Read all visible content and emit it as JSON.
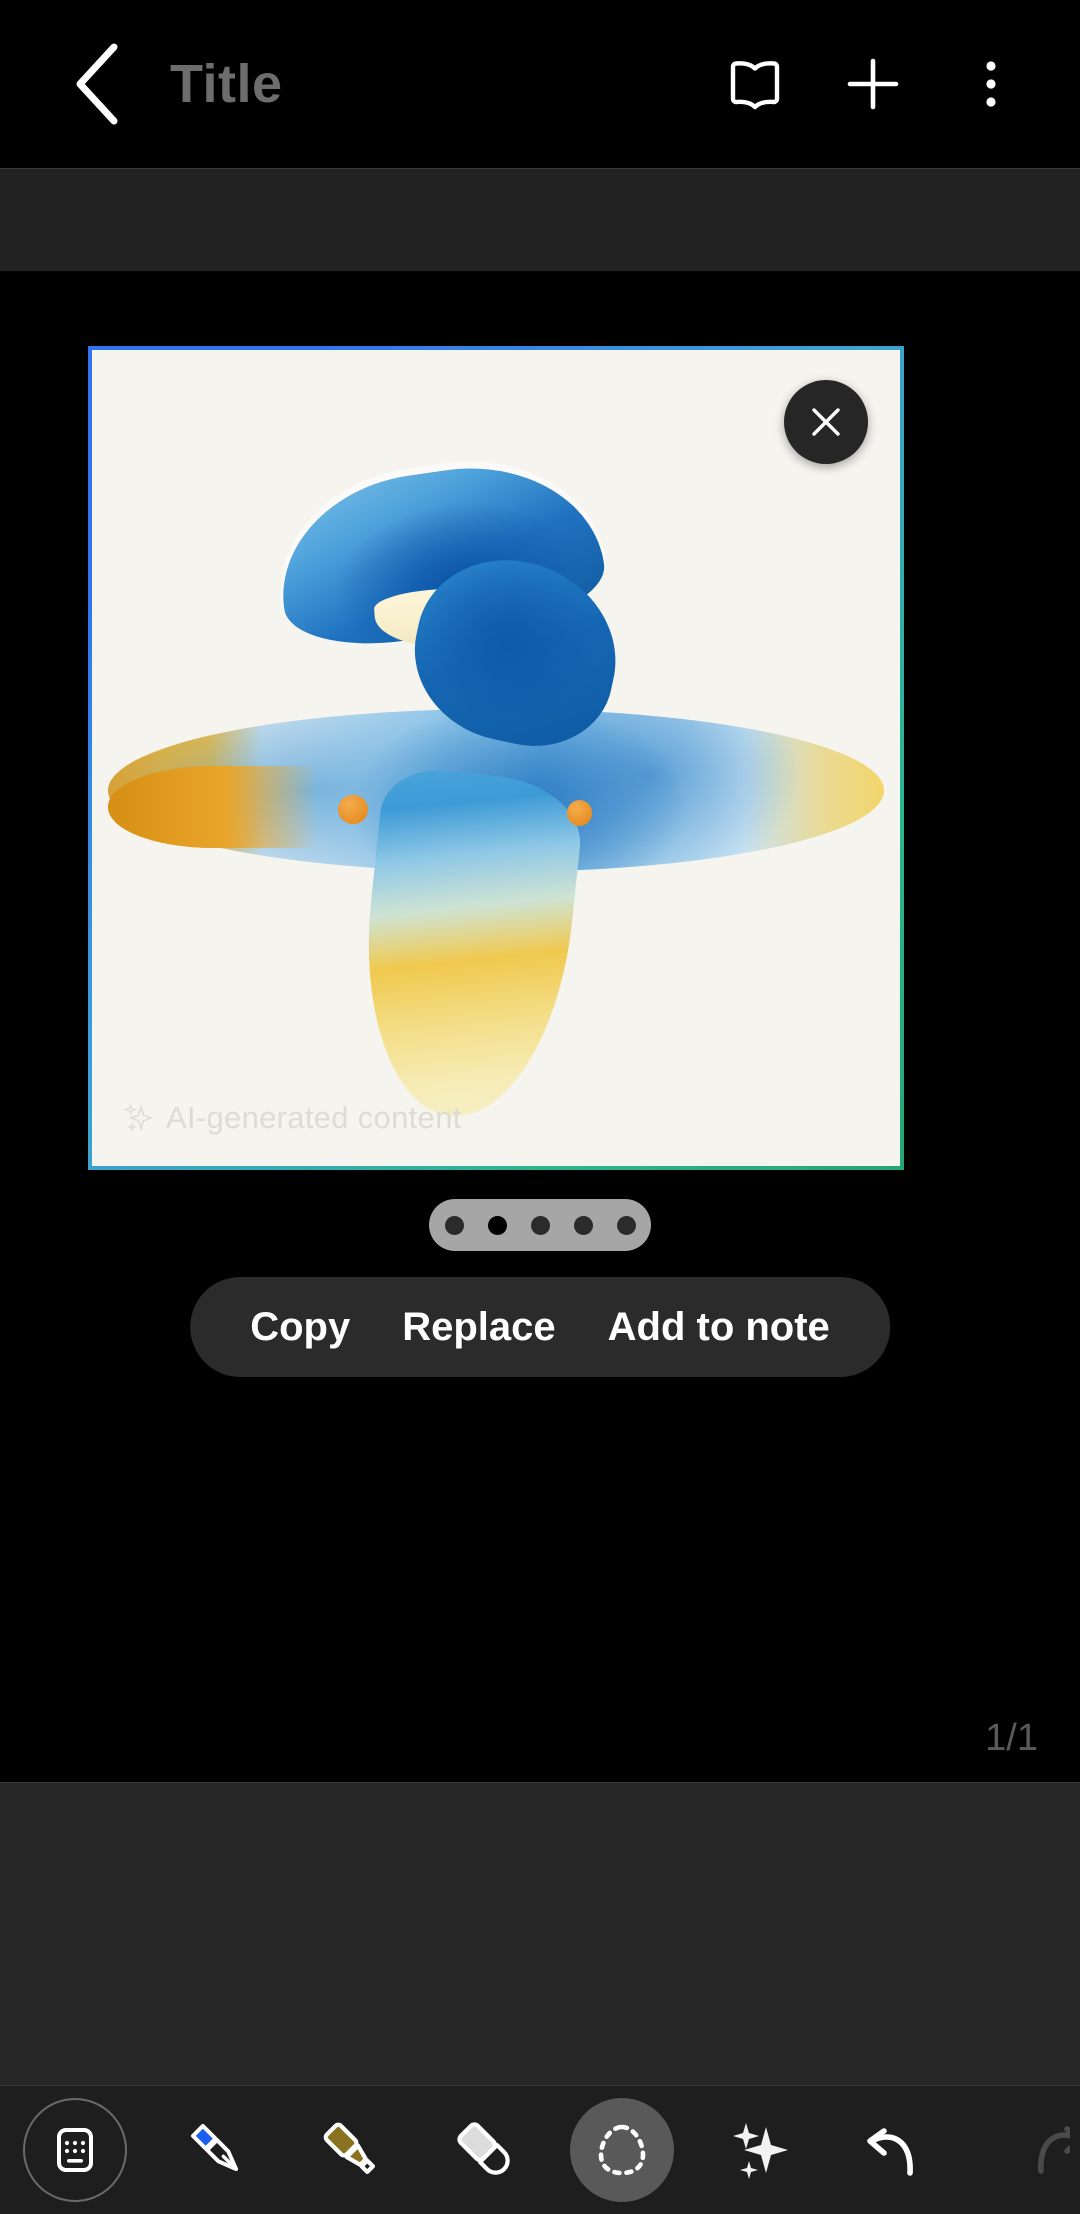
{
  "app": {
    "title": "Title",
    "theme": "dark"
  },
  "appbar": {
    "back_label": "Back",
    "title": "Title",
    "actions": [
      {
        "name": "reading-mode",
        "icon": "book-icon",
        "label": "Reading mode"
      },
      {
        "name": "insert",
        "icon": "plus-icon",
        "label": "Insert"
      },
      {
        "name": "more-options",
        "icon": "kebab-menu-icon",
        "label": "More options"
      }
    ]
  },
  "canvas": {
    "page_counter": "1/1",
    "image_card": {
      "watermark": "AI-generated content",
      "watermark_icon": "sparkle-icon",
      "close_label": "Close",
      "border_gradient_from": "#2f74ef",
      "border_gradient_to": "#25a577",
      "paper_color": "#f6f4ef",
      "artwork": {
        "style": "watercolor-abstract",
        "subject": "abstract bird-fish form",
        "palette": [
          "#e9a227",
          "#f2d66a",
          "#8fc6e8",
          "#1f72c0",
          "#0f5ba4",
          "#fdf6d9"
        ]
      }
    },
    "pagination": {
      "total_dots": 5,
      "active_index": 1
    },
    "actions": [
      {
        "name": "copy",
        "label": "Copy"
      },
      {
        "name": "replace",
        "label": "Replace"
      },
      {
        "name": "add-to-note",
        "label": "Add to note"
      }
    ]
  },
  "toolbar": {
    "items": [
      {
        "name": "keyboard",
        "icon": "keyboard-icon",
        "label": "Keyboard",
        "state": "outlined"
      },
      {
        "name": "pen",
        "icon": "pen-icon",
        "label": "Pen",
        "color": "#1b5ff0",
        "state": "normal"
      },
      {
        "name": "highlighter",
        "icon": "highlighter-icon",
        "label": "Highlighter",
        "color": "#8a7320",
        "state": "normal"
      },
      {
        "name": "eraser",
        "icon": "eraser-icon",
        "label": "Eraser",
        "color": "#dcdcdc",
        "state": "normal"
      },
      {
        "name": "lasso-select",
        "icon": "lasso-select-icon",
        "label": "Selection",
        "state": "selected"
      },
      {
        "name": "ai-assist",
        "icon": "sparkle-icon",
        "label": "AI assist",
        "state": "normal"
      },
      {
        "name": "undo",
        "icon": "undo-arrow-icon",
        "label": "Undo",
        "state": "normal"
      },
      {
        "name": "redo",
        "icon": "redo-arrow-icon",
        "label": "Redo",
        "state": "partial"
      }
    ]
  }
}
